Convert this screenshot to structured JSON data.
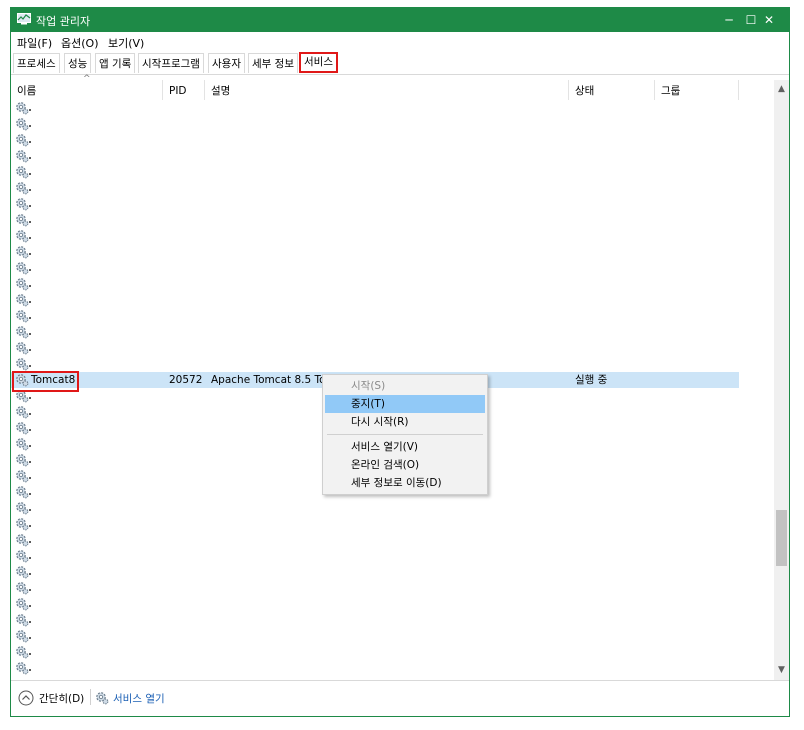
{
  "window": {
    "title": "작업 관리자",
    "controls": {
      "minimize": "─",
      "maximize": "☐",
      "close": "✕"
    }
  },
  "menu": [
    "파일(F)",
    "옵션(O)",
    "보기(V)"
  ],
  "tabs": [
    "프로세스",
    "성능",
    "앱 기록",
    "시작프로그램",
    "사용자",
    "세부 정보",
    "서비스"
  ],
  "active_tab": "서비스",
  "columns": {
    "name": "이름",
    "pid": "PID",
    "description": "설명",
    "status": "상태",
    "group": "그룹"
  },
  "selected_row": {
    "name": "Tomcat8",
    "pid": "20572",
    "description": "Apache Tomcat 8.5 Tom",
    "status": "실행 중",
    "group": ""
  },
  "context_menu": {
    "start": "시작(S)",
    "stop": "중지(T)",
    "restart": "다시 시작(R)",
    "open_services": "서비스 열기(V)",
    "search_online": "온라인 검색(O)",
    "go_to_details": "세부 정보로 이동(D)"
  },
  "footer": {
    "collapse": "간단히(D)",
    "open_services": "서비스 열기"
  },
  "scrollbar": {
    "up": "▲",
    "down": "▼"
  },
  "colors": {
    "titlebar": "#1e8a47",
    "highlight_box": "#e01818",
    "selected_row": "#cce4f7",
    "menu_hover": "#91c9f7",
    "link": "#1a5fb4"
  },
  "icons": {
    "row_icon": "gear-icon",
    "app_icon": "task-manager-icon",
    "collapse_icon": "chevron-up-circle-icon"
  }
}
